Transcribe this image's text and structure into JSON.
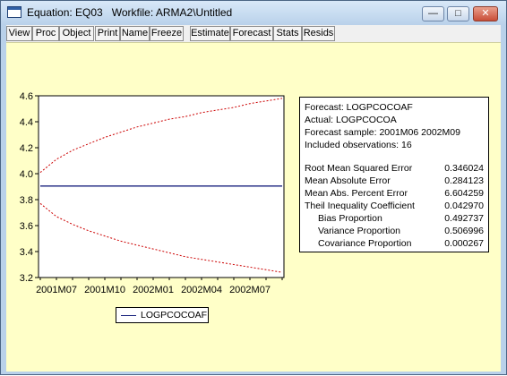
{
  "window": {
    "title": "Equation: EQ03   Workfile: ARMA2\\Untitled",
    "minimize_glyph": "—",
    "maximize_glyph": "□",
    "close_glyph": "✕"
  },
  "toolbar": {
    "items": [
      "View",
      "Proc",
      "Object",
      "Print",
      "Name",
      "Freeze",
      "Estimate",
      "Forecast",
      "Stats",
      "Resids"
    ]
  },
  "colors": {
    "content_bg": "#ffffc8",
    "forecast_line": "#1a237e",
    "band_line": "#cc0000"
  },
  "chart_data": {
    "type": "line",
    "series": [
      {
        "name": "LOGPCOCOAF",
        "values": [
          3.905,
          3.905,
          3.905,
          3.905,
          3.905,
          3.905,
          3.905,
          3.905,
          3.905,
          3.905,
          3.905,
          3.905,
          3.905,
          3.905,
          3.905,
          3.905
        ]
      },
      {
        "values": [
          4.01,
          4.11,
          4.18,
          4.23,
          4.28,
          4.32,
          4.36,
          4.39,
          4.42,
          4.44,
          4.47,
          4.49,
          4.51,
          4.54,
          4.56,
          4.58
        ]
      },
      {
        "values": [
          3.77,
          3.67,
          3.61,
          3.56,
          3.52,
          3.48,
          3.45,
          3.42,
          3.39,
          3.36,
          3.34,
          3.32,
          3.3,
          3.28,
          3.26,
          3.24
        ]
      }
    ],
    "ylim": [
      3.2,
      4.6
    ],
    "yticks": [
      "3.2",
      "3.4",
      "3.6",
      "3.8",
      "4.0",
      "4.2",
      "4.4",
      "4.6"
    ],
    "xtick_labels": [
      "2001M07",
      "2001M10",
      "2002M01",
      "2002M04",
      "2002M07"
    ],
    "legend": "bottom"
  },
  "stats": {
    "header": [
      "Forecast: LOGPCOCOAF",
      "Actual: LOGPCOCOA",
      "Forecast sample: 2001M06 2002M09",
      "Included observations: 16"
    ],
    "rows": [
      {
        "label": "Root Mean Squared Error",
        "value": "0.346024"
      },
      {
        "label": "Mean Absolute Error",
        "value": "0.284123"
      },
      {
        "label": "Mean Abs. Percent Error",
        "value": "6.604259"
      },
      {
        "label": "Theil Inequality Coefficient",
        "value": "0.042970"
      },
      {
        "label": "Bias Proportion",
        "value": "0.492737"
      },
      {
        "label": "Variance Proportion",
        "value": "0.506996"
      },
      {
        "label": "Covariance Proportion",
        "value": "0.000267"
      }
    ]
  }
}
